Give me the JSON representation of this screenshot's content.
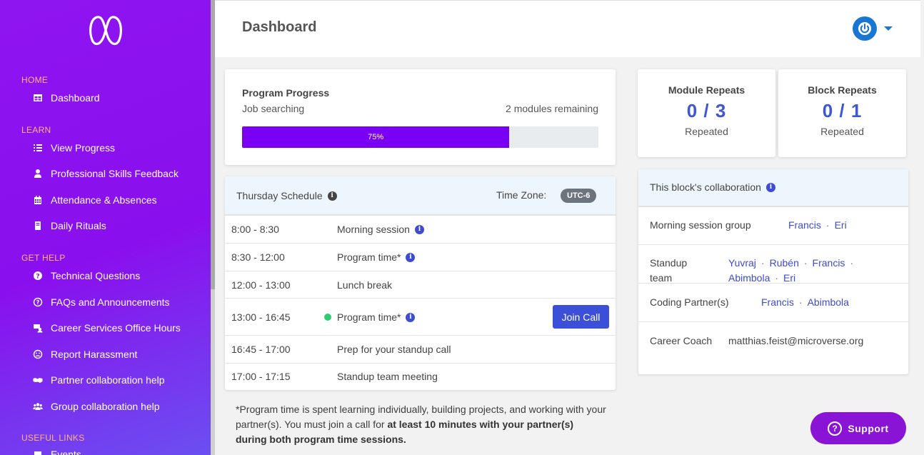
{
  "sidebar": {
    "sections": [
      {
        "title": "HOME",
        "items": [
          {
            "label": "Dashboard",
            "icon": "table-icon"
          }
        ]
      },
      {
        "title": "LEARN",
        "items": [
          {
            "label": "View Progress",
            "icon": "list-icon"
          },
          {
            "label": "Professional Skills Feedback",
            "icon": "user-tie-icon"
          },
          {
            "label": "Attendance & Absences",
            "icon": "calendar-icon"
          },
          {
            "label": "Daily Rituals",
            "icon": "book-icon"
          }
        ]
      },
      {
        "title": "GET HELP",
        "items": [
          {
            "label": "Technical Questions",
            "icon": "question-circle-icon"
          },
          {
            "label": "FAQs and Announcements",
            "icon": "question-outline-icon"
          },
          {
            "label": "Career Services Office Hours",
            "icon": "career-icon"
          },
          {
            "label": "Report Harassment",
            "icon": "frown-icon"
          },
          {
            "label": "Partner collaboration help",
            "icon": "handshake-icon"
          },
          {
            "label": "Group collaboration help",
            "icon": "group-icon"
          }
        ]
      },
      {
        "title": "USEFUL LINKS",
        "items": [
          {
            "label": "Events",
            "icon": "calendar-icon"
          }
        ]
      }
    ]
  },
  "header": {
    "title": "Dashboard",
    "avatar_icon": "power-icon"
  },
  "progress": {
    "title": "Program Progress",
    "subtitle": "Job searching",
    "remaining": "2 modules remaining",
    "percent": 75,
    "percent_label": "75%"
  },
  "stats": [
    {
      "title": "Module Repeats",
      "value": "0 / 3",
      "label": "Repeated"
    },
    {
      "title": "Block Repeats",
      "value": "0 / 1",
      "label": "Repeated"
    }
  ],
  "schedule": {
    "title": "Thursday Schedule",
    "tz_label": "Time Zone:",
    "tz_value": "UTC-6",
    "rows": [
      {
        "time": "8:00 - 8:30",
        "activity": "Morning session",
        "info": true
      },
      {
        "time": "8:30 - 12:00",
        "activity": "Program time*",
        "info": true
      },
      {
        "time": "12:00 - 13:00",
        "activity": "Lunch break",
        "info": false
      },
      {
        "time": "13:00 - 16:45",
        "activity": "Program time*",
        "info": true,
        "live": true,
        "button": "Join Call"
      },
      {
        "time": "16:45 - 17:00",
        "activity": "Prep for your standup call",
        "info": false
      },
      {
        "time": "17:00 - 17:15",
        "activity": "Standup team meeting",
        "info": false
      }
    ],
    "footnote_plain": "*Program time is spent learning individually, building projects, and working with your partner(s). You must join a call for ",
    "footnote_bold": "at least 10 minutes with your partner(s) during both program time sessions."
  },
  "collaboration": {
    "title": "This block's collaboration",
    "rows": [
      {
        "label": "Morning session group",
        "people": [
          "Francis",
          "Eri"
        ]
      },
      {
        "label": "Standup team",
        "people_line1": [
          "Yuvraj",
          "Rubén",
          "Francis"
        ],
        "people_line2": [
          "Abimbola",
          "Eri"
        ]
      },
      {
        "label": "Coding Partner(s)",
        "people": [
          "Francis",
          "Abimbola"
        ]
      },
      {
        "label": "Career Coach",
        "value": "matthias.feist@microverse.org"
      }
    ]
  },
  "support": {
    "label": "Support"
  },
  "colors": {
    "sidebar": "#8a0fee",
    "accent": "#3e56d8",
    "progress": "#7a00f5",
    "support": "#8a14d6"
  }
}
